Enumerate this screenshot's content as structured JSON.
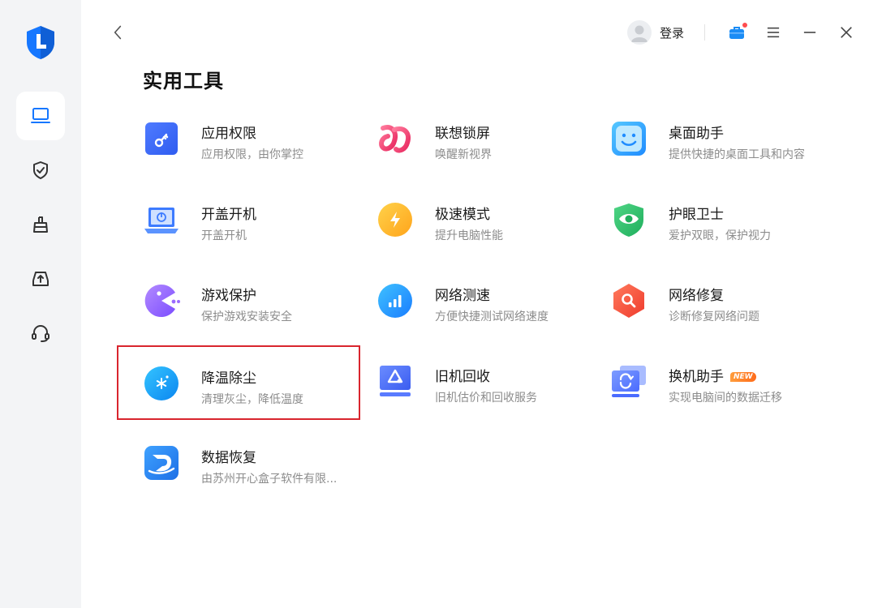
{
  "header": {
    "login_label": "登录"
  },
  "page": {
    "title": "实用工具"
  },
  "colors": {
    "brand": "#1677ff",
    "highlight_border": "#d9252e",
    "badge_bg": "#ff7a1f"
  },
  "sidebar": {
    "items": [
      {
        "icon": "laptop-icon",
        "active": true
      },
      {
        "icon": "shield-check-icon",
        "active": false
      },
      {
        "icon": "cleaning-brush-icon",
        "active": false
      },
      {
        "icon": "upload-tray-icon",
        "active": false
      },
      {
        "icon": "headset-icon",
        "active": false
      }
    ]
  },
  "tools": [
    {
      "name": "应用权限",
      "desc": "应用权限，由你掌控",
      "icon": "app-permission-icon"
    },
    {
      "name": "联想锁屏",
      "desc": "唤醒新视界",
      "icon": "lenovo-lockscreen-icon"
    },
    {
      "name": "桌面助手",
      "desc": "提供快捷的桌面工具和内容",
      "icon": "desktop-assistant-icon"
    },
    {
      "name": "开盖开机",
      "desc": "开盖开机",
      "icon": "lid-open-boot-icon"
    },
    {
      "name": "极速模式",
      "desc": "提升电脑性能",
      "icon": "turbo-mode-icon"
    },
    {
      "name": "护眼卫士",
      "desc": "爱护双眼，保护视力",
      "icon": "eye-care-icon"
    },
    {
      "name": "游戏保护",
      "desc": "保护游戏安装安全",
      "icon": "game-protect-icon"
    },
    {
      "name": "网络测速",
      "desc": "方便快捷测试网络速度",
      "icon": "network-speed-icon"
    },
    {
      "name": "网络修复",
      "desc": "诊断修复网络问题",
      "icon": "network-repair-icon"
    },
    {
      "name": "降温除尘",
      "desc": "清理灰尘，降低温度",
      "icon": "cooling-dust-icon",
      "highlighted": true
    },
    {
      "name": "旧机回收",
      "desc": "旧机估价和回收服务",
      "icon": "device-recycle-icon"
    },
    {
      "name": "换机助手",
      "desc": "实现电脑间的数据迁移",
      "icon": "device-migration-icon",
      "badge": "NEW"
    },
    {
      "name": "数据恢复",
      "desc": "由苏州开心盒子软件有限...",
      "icon": "data-recovery-icon"
    }
  ]
}
